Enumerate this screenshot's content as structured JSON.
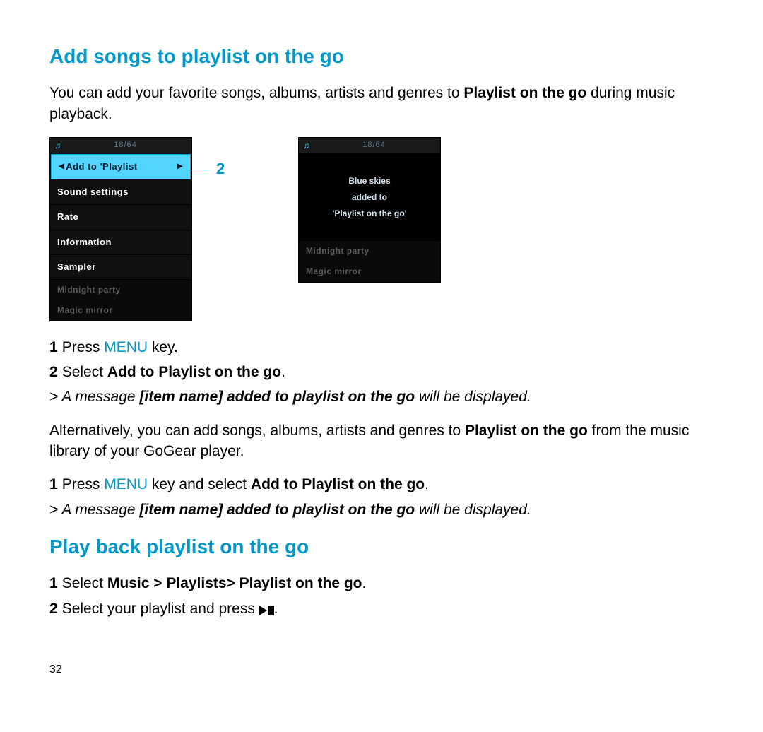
{
  "section1": {
    "heading": "Add songs to playlist on the go",
    "intro_pre": "You can add your favorite songs, albums, artists and genres to ",
    "intro_strong": "Playlist on the go",
    "intro_post": " during music playback."
  },
  "screen1": {
    "counter": "18/64",
    "items": [
      "Add to 'Playlist",
      "Sound settings",
      "Rate",
      "Information",
      "Sampler"
    ],
    "faded": [
      "Midnight party",
      "Magic mirror"
    ]
  },
  "screen2": {
    "counter": "18/64",
    "confirm": [
      "Blue skies",
      "added to",
      "'Playlist on the go'"
    ],
    "faded": [
      "Midnight party",
      "Magic mirror"
    ]
  },
  "callout": "2",
  "steps_a": {
    "s1_pre": "Press ",
    "s1_key": "MENU",
    "s1_post": " key.",
    "s2_pre": "Select ",
    "s2_strong": "Add to Playlist on the go",
    "s2_post": ".",
    "result_pre": "> A message ",
    "result_strong": "[item name] added to playlist on the go",
    "result_post": " will be displayed."
  },
  "alt": {
    "pre": "Alternatively, you can add songs, albums, artists and genres to ",
    "strong": "Playlist on the go",
    "post": " from the music library of your GoGear player."
  },
  "steps_b": {
    "s1_pre": "Press ",
    "s1_key": "MENU",
    "s1_mid": " key and select ",
    "s1_strong": "Add to Playlist on the go",
    "s1_post": ".",
    "result_pre": "> A message ",
    "result_strong": "[item name] added to playlist on the go",
    "result_post": " will be displayed."
  },
  "section2": {
    "heading": "Play back playlist on the go",
    "s1_pre": "Select ",
    "s1_strong": "Music > Playlists> Playlist on the go",
    "s1_post": ".",
    "s2_pre": "Select your playlist and press ",
    "s2_post": "."
  },
  "page_number": "32"
}
